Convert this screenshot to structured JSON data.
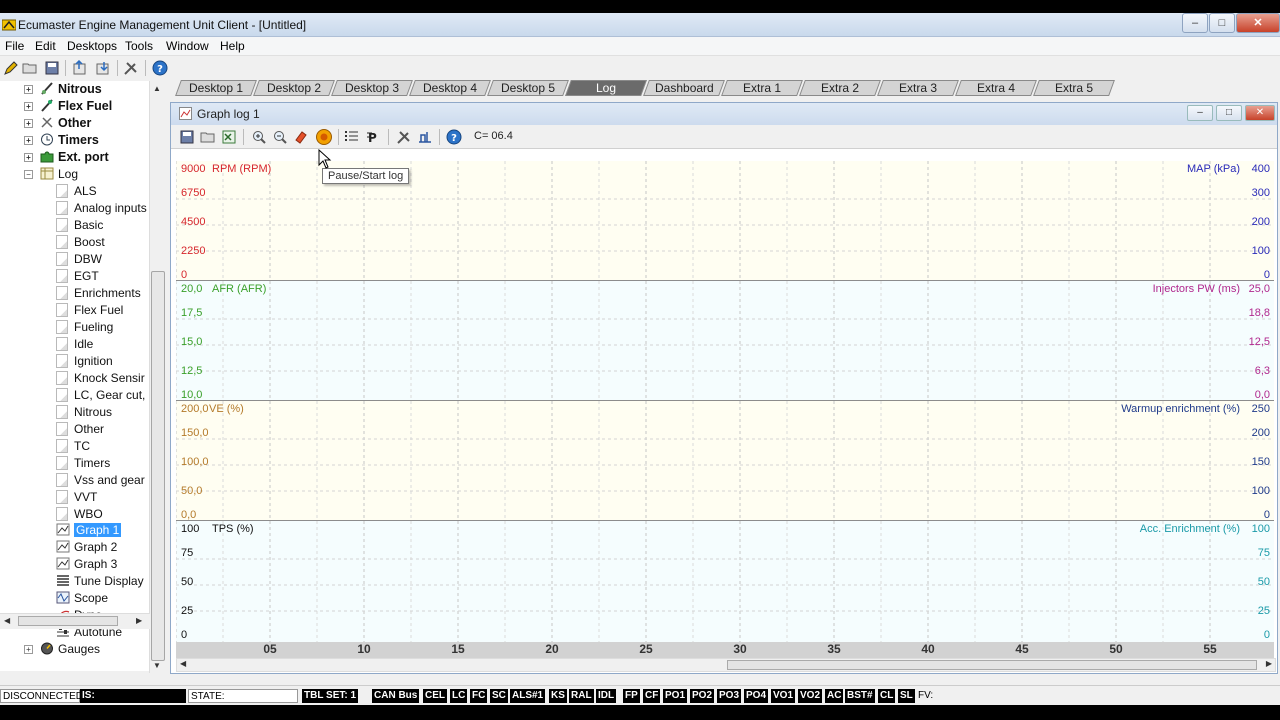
{
  "window": {
    "title": "Ecumaster Engine Management Unit Client - [Untitled]",
    "minimize": "–",
    "maximize": "□",
    "close": "✕"
  },
  "menu": [
    "File",
    "Edit",
    "Desktops",
    "Tools",
    "Window",
    "Help"
  ],
  "toolbar_icons": [
    "pencil-icon",
    "open-folder-icon",
    "save-icon",
    "upload-icon",
    "download-icon",
    "tools-icon",
    "help-icon"
  ],
  "desktop_tabs": [
    "Desktop 1",
    "Desktop 2",
    "Desktop 3",
    "Desktop 4",
    "Desktop 5",
    "Log",
    "Dashboard",
    "Extra 1",
    "Extra 2",
    "Extra 3",
    "Extra 4",
    "Extra 5"
  ],
  "active_tab": "Log",
  "tree": {
    "top_items": [
      {
        "label": "Nitrous"
      },
      {
        "label": "Flex Fuel"
      },
      {
        "label": "Other"
      },
      {
        "label": "Timers"
      },
      {
        "label": "Ext. port"
      }
    ],
    "log_label": "Log",
    "log_children": [
      "ALS",
      "Analog inputs",
      "Basic",
      "Boost",
      "DBW",
      "EGT",
      "Enrichments",
      "Flex Fuel",
      "Fueling",
      "Idle",
      "Ignition",
      "Knock Sensir",
      "LC, Gear cut,",
      "Nitrous",
      "Other",
      "TC",
      "Timers",
      "Vss and gear",
      "VVT",
      "WBO"
    ],
    "graphs": [
      "Graph 1",
      "Graph 2",
      "Graph 3",
      "Tune Display",
      "Scope",
      "Dyno",
      "Autotune"
    ],
    "selected": "Graph 1",
    "gauges_label": "Gauges"
  },
  "graph_window": {
    "title": "Graph log 1",
    "counter": "C= 06.4",
    "tooltip": "Pause/Start log"
  },
  "panels": [
    {
      "left_title": "RPM (RPM)",
      "left_color": "#d6262c",
      "left_ticks": [
        "9000",
        "6750",
        "4500",
        "2250",
        "0"
      ],
      "right_title": "MAP (kPa)",
      "right_color": "#2a2ab8",
      "right_ticks": [
        "400",
        "300",
        "200",
        "100",
        "0"
      ]
    },
    {
      "left_title": "AFR (AFR)",
      "left_color": "#3aa02a",
      "left_ticks": [
        "20,0",
        "17,5",
        "15,0",
        "12,5",
        "10,0"
      ],
      "right_title": "Injectors PW (ms)",
      "right_color": "#b0288e",
      "right_ticks": [
        "25,0",
        "18,8",
        "12,5",
        "6,3",
        "0,0"
      ]
    },
    {
      "left_title": "VE (%)",
      "left_color": "#b47a2a",
      "left_ticks": [
        "200,0",
        "150,0",
        "100,0",
        "50,0",
        "0,0"
      ],
      "right_title": "Warmup enrichment (%)",
      "right_color": "#1f3a8a",
      "right_ticks": [
        "250",
        "200",
        "150",
        "100",
        "0"
      ]
    },
    {
      "left_title": "TPS (%)",
      "left_color": "#111111",
      "left_ticks": [
        "100",
        "75",
        "50",
        "25",
        "0"
      ],
      "right_title": "Acc. Enrichment (%)",
      "right_color": "#1a9aa8",
      "right_ticks": [
        "100",
        "75",
        "50",
        "25",
        "0"
      ]
    }
  ],
  "x_ticks": [
    "05",
    "10",
    "15",
    "20",
    "25",
    "30",
    "35",
    "40",
    "45",
    "50",
    "55"
  ],
  "status": {
    "connection": "DISCONNECTED",
    "is_label": "IS:",
    "state_label": "STATE:",
    "flags": [
      "TBL SET: 1",
      "CAN Bus",
      "CEL",
      "LC",
      "FC",
      "SC",
      "ALS#1",
      "KS",
      "RAL",
      "IDL",
      "FP",
      "CF",
      "PO1",
      "PO2",
      "PO3",
      "PO4",
      "VO1",
      "VO2",
      "AC",
      "BST#",
      "CL",
      "SL"
    ],
    "fv_label": "FV:"
  }
}
